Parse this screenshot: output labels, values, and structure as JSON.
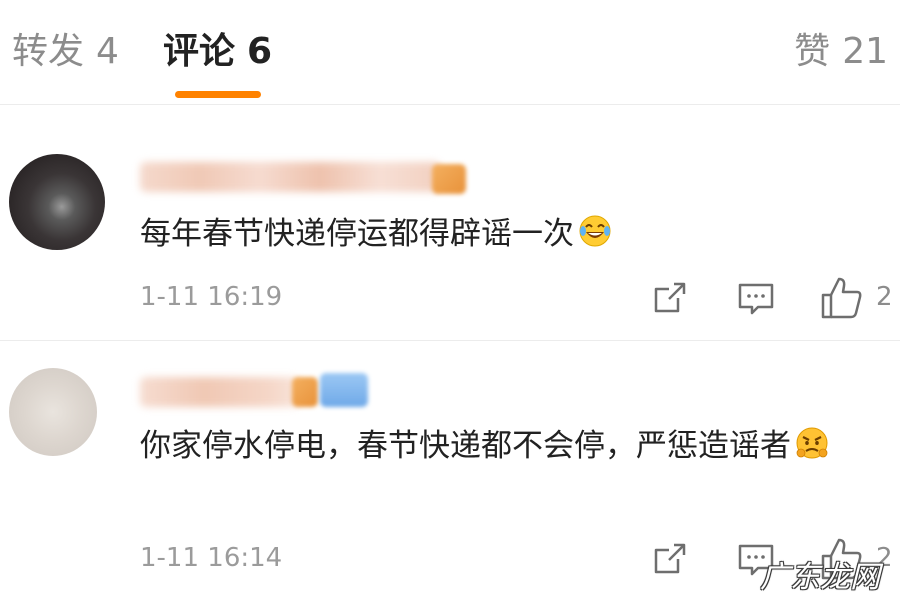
{
  "tabs": {
    "reposts": {
      "label": "转发",
      "count": "4"
    },
    "comments": {
      "label": "评论",
      "count": "6"
    },
    "likes": {
      "label": "赞",
      "count": "21"
    }
  },
  "accent_color": "#ff8200",
  "comments": [
    {
      "text": "每年春节快递停运都得辟谣一次",
      "emoji": "laughing-tears-emoji",
      "timestamp": "1-11 16:19",
      "like_count": "2"
    },
    {
      "text": "你家停水停电，春节快递都不会停，严惩造谣者",
      "emoji": "angry-face-emoji",
      "timestamp": "1-11 16:14",
      "like_count": "2"
    }
  ],
  "watermark": "广东龙网"
}
